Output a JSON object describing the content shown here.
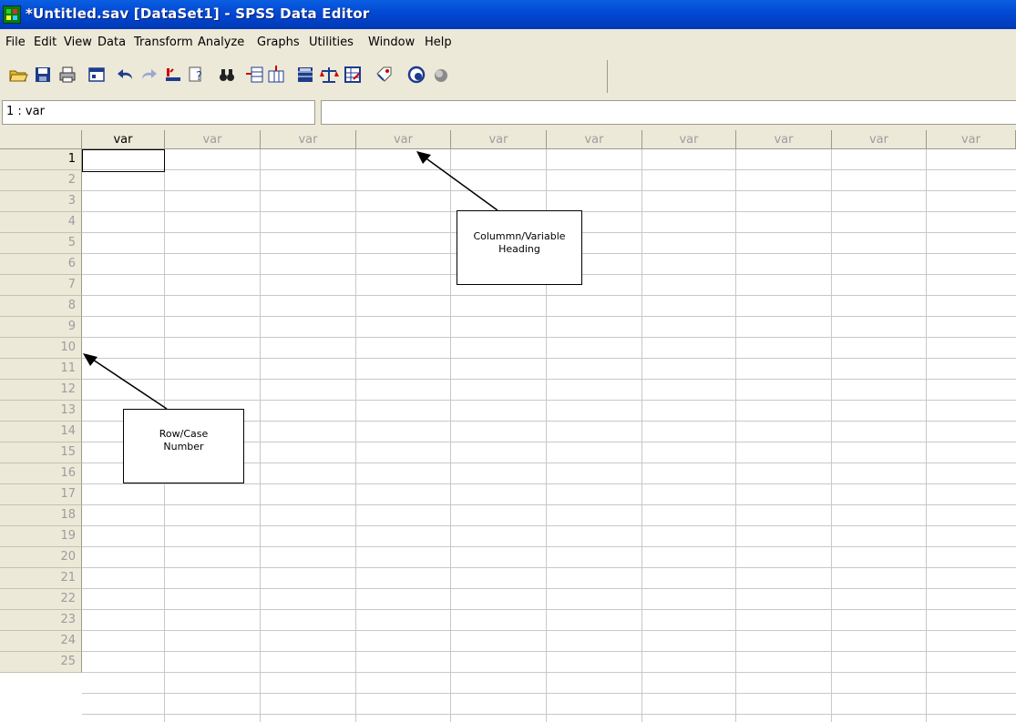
{
  "window": {
    "title": "*Untitled.sav [DataSet1] - SPSS Data Editor"
  },
  "menu": [
    "File",
    "Edit",
    "View",
    "Data",
    "Transform",
    "Analyze",
    "Graphs",
    "Utilities",
    "Window",
    "Help"
  ],
  "toolbar": {
    "icons": [
      "open-icon",
      "save-icon",
      "print-icon",
      "dialog-recall-icon",
      "undo-icon",
      "redo-icon",
      "goto-chart-icon",
      "goto-case-icon",
      "find-icon",
      "insert-cases-icon",
      "insert-variable-icon",
      "split-file-icon",
      "weight-cases-icon",
      "select-cases-icon",
      "value-labels-icon",
      "use-sets-icon",
      "show-all-icon"
    ]
  },
  "editor": {
    "cell_ref": "1 : var",
    "cell_value": ""
  },
  "grid": {
    "columns": [
      "var",
      "var",
      "var",
      "var",
      "var",
      "var",
      "var",
      "var",
      "var",
      "var"
    ],
    "rows": [
      "1",
      "2",
      "3",
      "4",
      "5",
      "6",
      "7",
      "8",
      "9",
      "10",
      "11",
      "12",
      "13",
      "14",
      "15",
      "16",
      "17",
      "18",
      "19",
      "20",
      "21",
      "22",
      "23",
      "24",
      "25"
    ]
  },
  "annotations": {
    "column_heading": [
      "Colummn/Variable",
      "Heading"
    ],
    "row_number": [
      "Row/Case",
      "Number"
    ]
  },
  "colors": {
    "titlebar": "#0248d4",
    "chrome": "#ece9d8",
    "header_text_inactive": "#9d9d9d"
  }
}
